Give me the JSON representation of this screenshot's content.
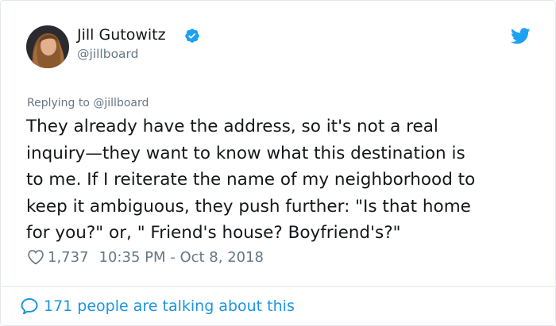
{
  "tweet": {
    "author_name": "Jill Gutowitz",
    "author_handle": "@jillboard",
    "replying_prefix": "Replying to ",
    "replying_to": "@jillboard",
    "text_lines": [
      "They already have the address, so it's not a real",
      "inquiry—they want to know what this destination is",
      "to me. If I reiterate the name of my neighborhood to",
      "keep it ambiguous, they push further: \"Is that home",
      "for you?\" or, \" Friend's house? Boyfriend's?\""
    ],
    "like_count": "1,737",
    "timestamp": "10:35 PM - Oct 8, 2018"
  },
  "footer": {
    "talking": "171 people are talking about this"
  },
  "icons": {
    "verified": "verified-badge-icon",
    "brand": "twitter-bird-icon",
    "like": "heart-icon",
    "reply": "speech-bubble-icon"
  },
  "colors": {
    "brand_blue": "#1da1f2",
    "link_blue": "#1b95e0",
    "secondary_text": "#657786",
    "primary_text": "#14171a",
    "divider": "#e1e8ed"
  }
}
